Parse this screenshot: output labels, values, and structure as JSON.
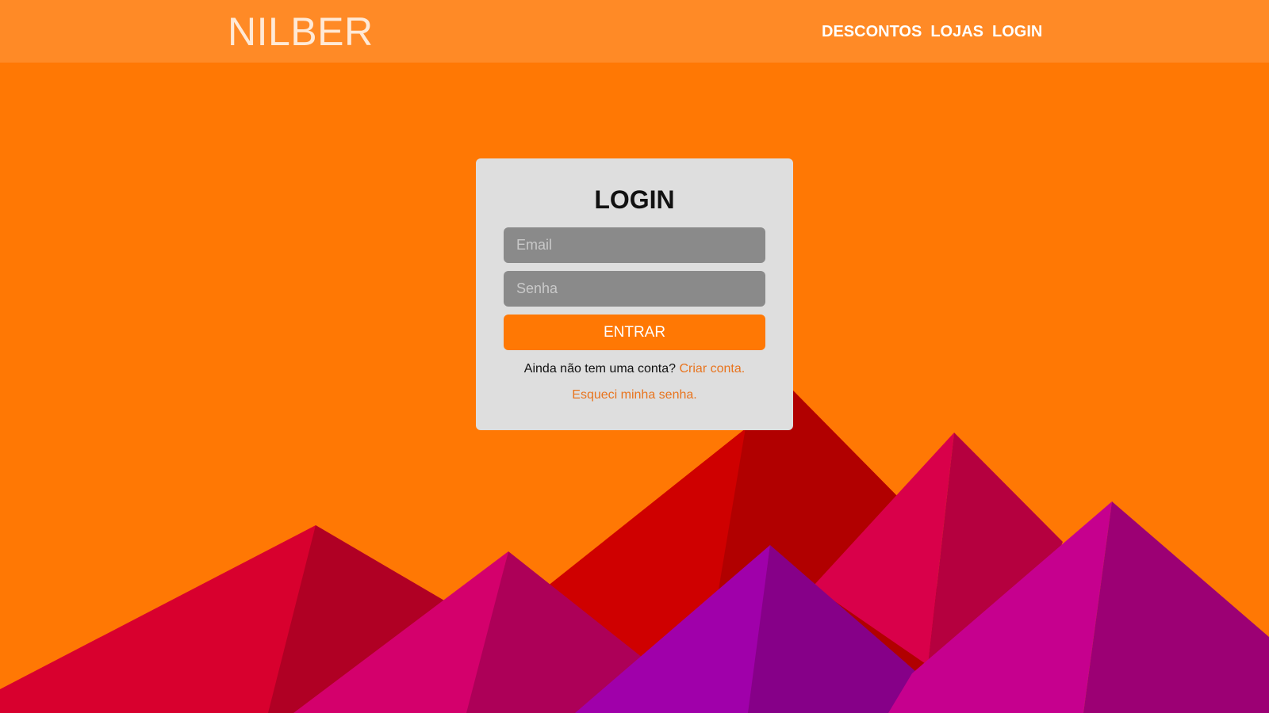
{
  "header": {
    "logo": "NILBER",
    "nav": [
      {
        "label": "DESCONTOS"
      },
      {
        "label": "LOJAS"
      },
      {
        "label": "LOGIN"
      }
    ]
  },
  "login": {
    "title": "LOGIN",
    "email_placeholder": "Email",
    "email_value": "",
    "password_placeholder": "Senha",
    "password_value": "",
    "submit_label": "ENTRAR",
    "no_account_text": "Ainda não tem uma conta?",
    "create_account_link": "Criar conta.",
    "forgot_password_link": "Esqueci minha senha."
  },
  "colors": {
    "background": "#ff7804",
    "navbar": "#ff8a26",
    "card": "#dedede",
    "input": "#8a8a8a",
    "link": "#e8741e"
  }
}
